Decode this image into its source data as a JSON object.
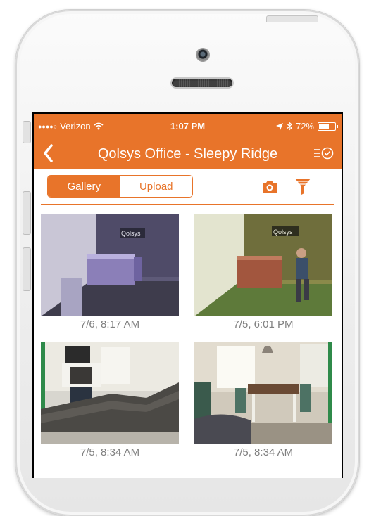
{
  "status_bar": {
    "signal": "●●●●○",
    "carrier": "Verizon",
    "time": "1:07 PM",
    "battery_text": "72%",
    "battery_level": 0.72
  },
  "nav": {
    "title": "Qolsys Office - Sleepy Ridge"
  },
  "toolbar": {
    "tabs": [
      {
        "label": "Gallery",
        "active": true
      },
      {
        "label": "Upload",
        "active": false
      }
    ]
  },
  "gallery": [
    {
      "caption": "7/6, 8:17 AM",
      "scene": "office-night"
    },
    {
      "caption": "7/5, 6:01 PM",
      "scene": "office-person"
    },
    {
      "caption": "7/5, 8:34 AM",
      "scene": "living-room"
    },
    {
      "caption": "7/5, 8:34 AM",
      "scene": "dining-room"
    }
  ],
  "colors": {
    "accent": "#e8742a",
    "caption": "#808080"
  },
  "icons": [
    "back-chevron-icon",
    "events-icon",
    "camera-icon",
    "filter-icon",
    "wifi-icon",
    "location-arrow-icon",
    "bluetooth-icon",
    "battery-icon"
  ]
}
